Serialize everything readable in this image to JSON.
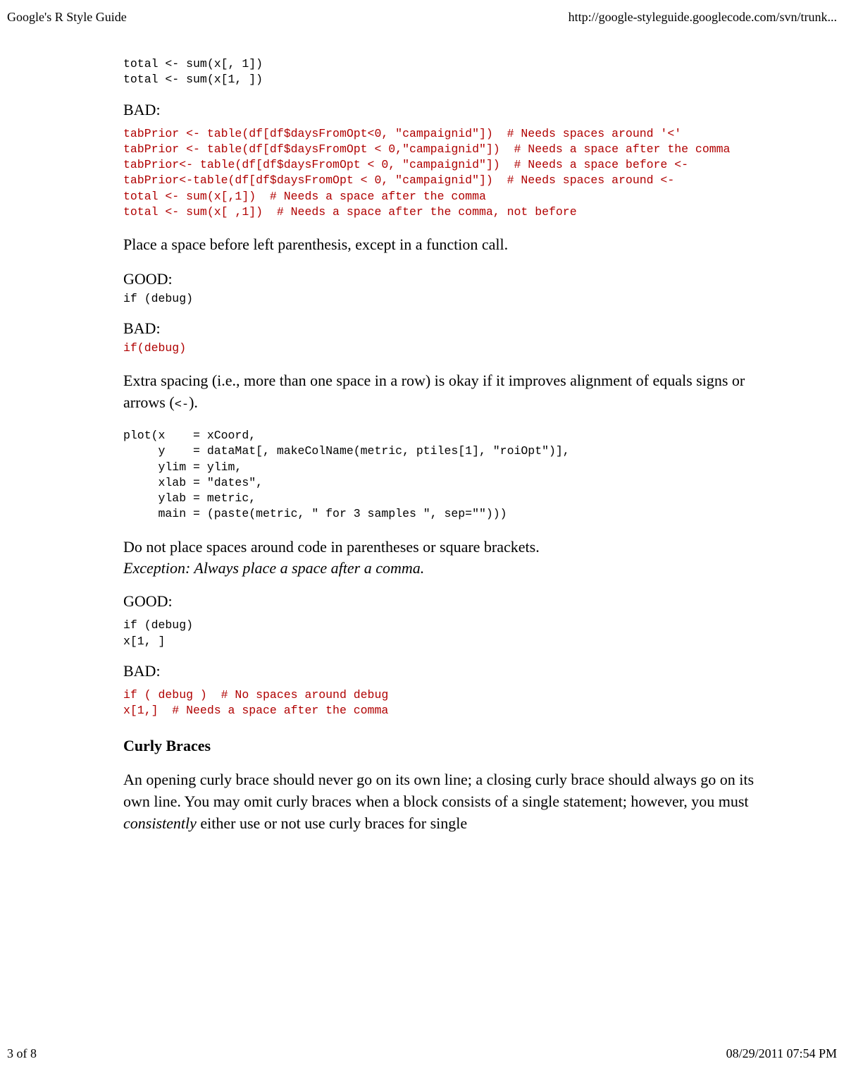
{
  "header": {
    "title_left": "Google's R Style Guide",
    "url_right": "http://google-styleguide.googlecode.com/svn/trunk..."
  },
  "footer": {
    "page_left": "3 of 8",
    "date_right": "08/29/2011 07:54 PM"
  },
  "body": {
    "code_good_top": "total <- sum(x[, 1])\ntotal <- sum(x[1, ])",
    "label_bad_1": "BAD:",
    "code_bad_1": "tabPrior <- table(df[df$daysFromOpt<0, \"campaignid\"])  # Needs spaces around '<'\ntabPrior <- table(df[df$daysFromOpt < 0,\"campaignid\"])  # Needs a space after the comma\ntabPrior<- table(df[df$daysFromOpt < 0, \"campaignid\"])  # Needs a space before <-\ntabPrior<-table(df[df$daysFromOpt < 0, \"campaignid\"])  # Needs spaces around <-\ntotal <- sum(x[,1])  # Needs a space after the comma\ntotal <- sum(x[ ,1])  # Needs a space after the comma, not before",
    "para_1": "Place a space before left parenthesis, except in a function call.",
    "label_good_2": "GOOD:",
    "code_good_2": "if (debug)",
    "label_bad_2": "BAD:",
    "code_bad_2": "if(debug)",
    "para_2a": "Extra spacing (i.e., more than one space in a row) is okay if it improves alignment of equals signs or arrows (",
    "para_2_inline": "<-",
    "para_2b": ").",
    "code_block_3": "plot(x    = xCoord,\n     y    = dataMat[, makeColName(metric, ptiles[1], \"roiOpt\")],\n     ylim = ylim,\n     xlab = \"dates\",\n     ylab = metric,\n     main = (paste(metric, \" for 3 samples \", sep=\"\")))",
    "para_3a": "Do not place spaces around code in parentheses or square brackets.",
    "para_3b": "Exception: Always place a space after a comma.",
    "label_good_4": "GOOD:",
    "code_good_4": "if (debug)\nx[1, ]",
    "label_bad_4": "BAD:",
    "code_bad_4": "if ( debug )  # No spaces around debug\nx[1,]  # Needs a space after the comma",
    "section_heading": "Curly Braces",
    "para_4a": "An opening curly brace should never go on its own line; a closing curly brace should always go on its own line. You may omit curly braces when a block consists of a single statement; however, you must ",
    "para_4_em": "consistently",
    "para_4b": " either use or not use curly braces for single"
  }
}
